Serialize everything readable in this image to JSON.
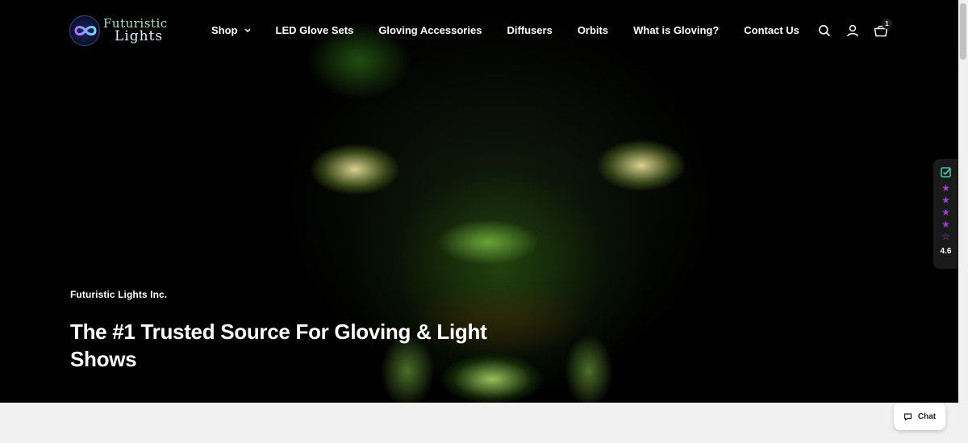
{
  "brand": {
    "logo_top": "Futuristic",
    "logo_bottom": "Lights"
  },
  "nav": {
    "items": [
      {
        "label": "Shop",
        "has_dropdown": true
      },
      {
        "label": "LED Glove Sets"
      },
      {
        "label": "Gloving Accessories"
      },
      {
        "label": "Diffusers"
      },
      {
        "label": "Orbits"
      },
      {
        "label": "What is Gloving?"
      },
      {
        "label": "Contact Us"
      }
    ]
  },
  "header_icons": {
    "search": "search-icon",
    "account": "account-icon",
    "cart": "cart-icon",
    "cart_count": "1"
  },
  "hero": {
    "eyebrow": "Futuristic Lights Inc.",
    "headline": "The #1 Trusted Source For Gloving & Light Shows"
  },
  "reviews_widget": {
    "rating": "4.6",
    "stars_filled": 4,
    "star_color": "#a03ed8",
    "check_color": "#3cc7b4"
  },
  "chat": {
    "label": "Chat"
  },
  "colors": {
    "header_bg": "#000000",
    "band_bg": "#f1f1f1",
    "text": "#ffffff"
  }
}
